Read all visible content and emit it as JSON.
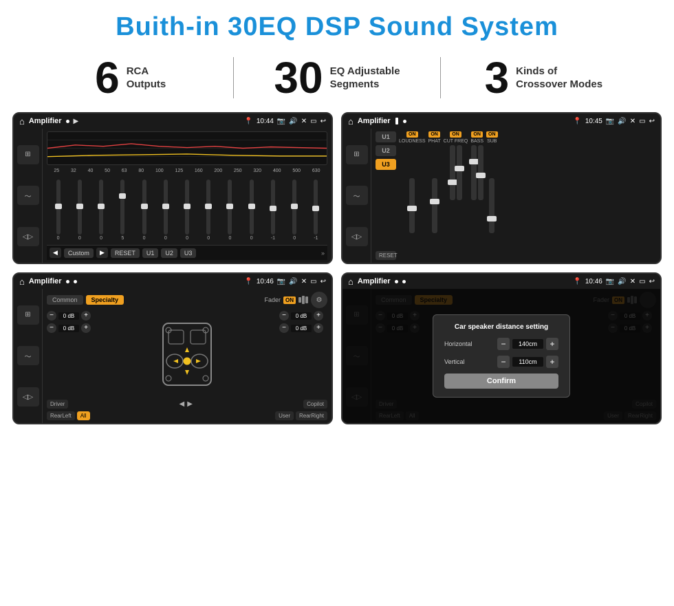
{
  "page": {
    "title": "Buith-in 30EQ DSP Sound System",
    "title_color": "#1a90d9"
  },
  "stats": [
    {
      "number": "6",
      "label": "RCA\nOutputs"
    },
    {
      "number": "30",
      "label": "EQ Adjustable\nSegments"
    },
    {
      "number": "3",
      "label": "Kinds of\nCrossover Modes"
    }
  ],
  "screen1": {
    "app": "Amplifier",
    "time": "10:44",
    "freq_labels": [
      "25",
      "32",
      "40",
      "50",
      "63",
      "80",
      "100",
      "125",
      "160",
      "200",
      "250",
      "320",
      "400",
      "500",
      "630"
    ],
    "slider_values": [
      "0",
      "0",
      "0",
      "5",
      "0",
      "0",
      "0",
      "0",
      "0",
      "0",
      "-1",
      "0",
      "-1"
    ],
    "preset": "Custom",
    "presets": [
      "RESET",
      "U1",
      "U2",
      "U3"
    ]
  },
  "screen2": {
    "app": "Amplifier",
    "time": "10:45",
    "channels": [
      "U1",
      "U2",
      "U3"
    ],
    "controls": [
      "LOUDNESS",
      "PHAT",
      "CUT FREQ",
      "BASS",
      "SUB"
    ],
    "on_labels": [
      "ON",
      "ON",
      "ON",
      "ON",
      "ON"
    ]
  },
  "screen3": {
    "app": "Amplifier",
    "time": "10:46",
    "tabs": [
      "Common",
      "Specialty"
    ],
    "fader_label": "Fader",
    "fader_on": "ON",
    "db_values": [
      "0 dB",
      "0 dB",
      "0 dB",
      "0 dB"
    ],
    "bottom_btns": [
      "Driver",
      "Copilot",
      "RearLeft",
      "All",
      "User",
      "RearRight"
    ]
  },
  "screen4": {
    "app": "Amplifier",
    "time": "10:46",
    "tabs": [
      "Common",
      "Specialty"
    ],
    "dialog": {
      "title": "Car speaker distance setting",
      "horizontal_label": "Horizontal",
      "horizontal_value": "140cm",
      "vertical_label": "Vertical",
      "vertical_value": "110cm",
      "confirm_label": "Confirm"
    },
    "bottom_btns": [
      "Driver",
      "Copilot",
      "RearLeft",
      "All",
      "User",
      "RearRight"
    ]
  }
}
